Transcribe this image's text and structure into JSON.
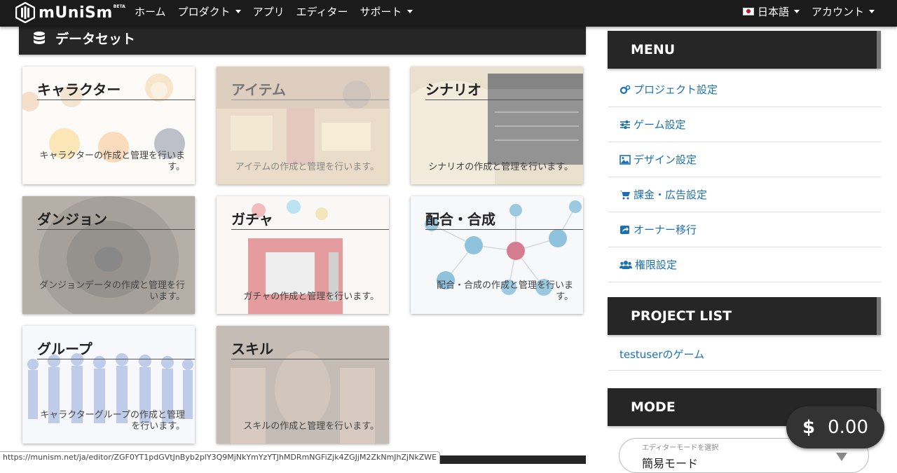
{
  "navbar": {
    "brand": "mUniSm",
    "brand_badge": "BETA",
    "items": [
      {
        "label": "ホーム",
        "dropdown": false
      },
      {
        "label": "プロダクト",
        "dropdown": true
      },
      {
        "label": "アプリ",
        "dropdown": false
      },
      {
        "label": "エディター",
        "dropdown": false
      },
      {
        "label": "サポート",
        "dropdown": true
      }
    ],
    "language": "日本語",
    "account": "アカウント"
  },
  "main": {
    "title": "データセット",
    "cards": [
      {
        "title": "キャラクター",
        "description": "キャラクターの作成と管理を行います。"
      },
      {
        "title": "アイテム",
        "description": "アイテムの作成と管理を行います。"
      },
      {
        "title": "シナリオ",
        "description": "シナリオの作成と管理を行います。"
      },
      {
        "title": "ダンジョン",
        "description": "ダンジョンデータの作成と管理を行います。"
      },
      {
        "title": "ガチャ",
        "description": "ガチャの作成と管理を行います。"
      },
      {
        "title": "配合・合成",
        "description": "配合・合成の作成と管理を行います。"
      },
      {
        "title": "グループ",
        "description": "キャラクターグループの作成と管理を行います。"
      },
      {
        "title": "スキル",
        "description": "スキルの作成と管理を行います。"
      }
    ]
  },
  "sidebar": {
    "menu_title": "MENU",
    "menu_items": [
      {
        "label": "プロジェクト設定",
        "icon": "gears-icon"
      },
      {
        "label": "ゲーム設定",
        "icon": "sliders-icon"
      },
      {
        "label": "デザイン設定",
        "icon": "image-icon"
      },
      {
        "label": "課金・広告設定",
        "icon": "cart-icon"
      },
      {
        "label": "オーナー移行",
        "icon": "share-icon"
      },
      {
        "label": "権限設定",
        "icon": "users-icon"
      }
    ],
    "project_list_title": "PROJECT LIST",
    "projects": [
      "testuserのゲーム"
    ],
    "mode_title": "MODE",
    "mode_select_label": "エディターモードを選択",
    "mode_select_value": "簡易モード"
  },
  "balance": {
    "symbol": "$",
    "amount": "0.00"
  },
  "status_url": "https://munism.net/ja/editor/ZGF0YT1pdGVtJnByb2plY3Q9MjNkYmYzYTJhMDRmNGFiZjk4ZGJjM2ZkNmJhZjNkZWE",
  "colors": {
    "accent_link": "#1a6fb5",
    "header_dark": "#262626",
    "navbar": "#1b1b1b"
  }
}
